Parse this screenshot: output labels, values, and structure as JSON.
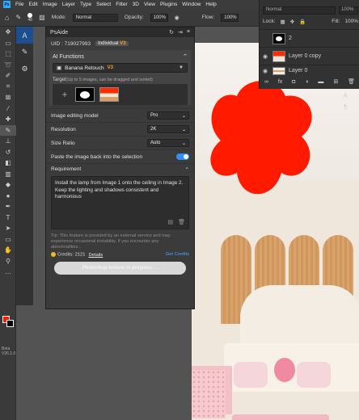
{
  "menubar": {
    "items": [
      "File",
      "Edit",
      "Image",
      "Layer",
      "Type",
      "Select",
      "Filter",
      "3D",
      "View",
      "Plugins",
      "Window",
      "Help"
    ]
  },
  "options": {
    "size": "48",
    "mode_label": "Mode:",
    "mode_value": "Normal",
    "opacity_label": "Opacity:",
    "opacity_value": "100%",
    "flow_label": "Flow:",
    "flow_value": "100%"
  },
  "layers_panel": {
    "blend_mode": "Normal",
    "opacity": "100%",
    "lock_label": "Lock:",
    "fill_label": "Fill:",
    "fill_value": "100%",
    "layers": [
      {
        "name": "2",
        "thumb": "mask"
      },
      {
        "name": "Layer 0 copy",
        "thumb": "red"
      },
      {
        "name": "Layer 0",
        "thumb": "room"
      }
    ]
  },
  "toolbar": {
    "beta_label": "Beta",
    "version": "V26.1.0"
  },
  "psaide": {
    "title": "PsAide",
    "uid": "UID : 719027993",
    "tier": "Individual",
    "tier_badge": "V3",
    "ai_functions_label": "AI Functions",
    "function_value": "Banana Retouch",
    "function_badge": "V3",
    "target_label": "Target",
    "target_hint": "(Up to 5 images, can be dragged and sorted)",
    "image_model_label": "Image editing model",
    "image_model_value": "Pro",
    "resolution_label": "Resolution",
    "resolution_value": "2K",
    "size_ratio_label": "Size Ratio",
    "size_ratio_value": "Auto",
    "paste_back_label": "Paste the image back into the selection",
    "paste_back_on": true,
    "requirement_label": "Requirement",
    "requirement_text": "Install the lamp from Image 1 onto the ceiling in Image 2. Keep the lighting and shadows consistent and harmonious",
    "tip": "Tip: This feature is provided by an external service and may experience occasional instability. If you encounter any abnormalities...",
    "credits_label": "Credits: 2121",
    "details_link": "Details",
    "get_credits_link": "Get Credits",
    "progress_label": "Photoshop texture in progress ..."
  }
}
